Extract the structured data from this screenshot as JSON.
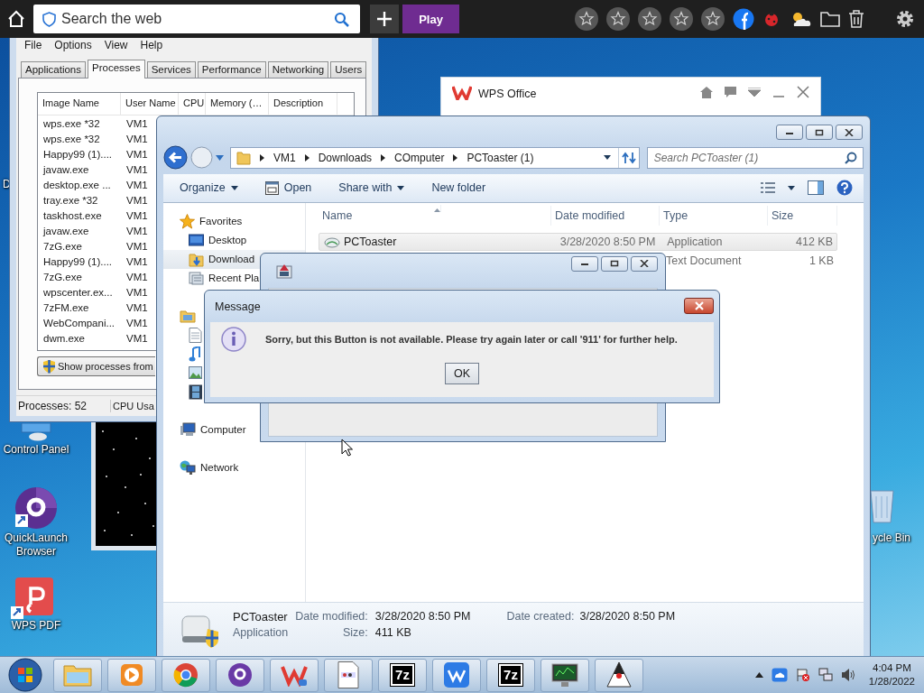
{
  "browser_bar": {
    "search": {
      "placeholder": "Search the web"
    },
    "play_button": "Play"
  },
  "desktop_icons": [
    {
      "label": "D",
      "kind": "none"
    },
    {
      "label": "Control Panel",
      "kind": "control"
    },
    {
      "label": "QuickLaunch Browser",
      "kind": "browser"
    },
    {
      "label": "WPS PDF",
      "kind": "pdf"
    },
    {
      "label": "ycle Bin",
      "kind": "trash"
    }
  ],
  "task_manager": {
    "menu": [
      "File",
      "Options",
      "View",
      "Help"
    ],
    "tabs": [
      {
        "label": "Applications",
        "selected": false
      },
      {
        "label": "Processes",
        "selected": true
      },
      {
        "label": "Services",
        "selected": false
      },
      {
        "label": "Performance",
        "selected": false
      },
      {
        "label": "Networking",
        "selected": false
      },
      {
        "label": "Users",
        "selected": false
      }
    ],
    "columns": [
      "Image Name",
      "User Name",
      "CPU",
      "Memory (…",
      "Description"
    ],
    "rows": [
      {
        "image_name": "wps.exe *32",
        "user_name": "VM1"
      },
      {
        "image_name": "wps.exe *32",
        "user_name": "VM1"
      },
      {
        "image_name": "Happy99 (1)....",
        "user_name": "VM1"
      },
      {
        "image_name": "javaw.exe",
        "user_name": "VM1"
      },
      {
        "image_name": "desktop.exe ...",
        "user_name": "VM1"
      },
      {
        "image_name": "tray.exe *32",
        "user_name": "VM1"
      },
      {
        "image_name": "taskhost.exe",
        "user_name": "VM1"
      },
      {
        "image_name": "javaw.exe",
        "user_name": "VM1"
      },
      {
        "image_name": "7zG.exe",
        "user_name": "VM1"
      },
      {
        "image_name": "Happy99 (1)....",
        "user_name": "VM1"
      },
      {
        "image_name": "7zG.exe",
        "user_name": "VM1"
      },
      {
        "image_name": "wpscenter.ex...",
        "user_name": "VM1"
      },
      {
        "image_name": "7zFM.exe",
        "user_name": "VM1"
      },
      {
        "image_name": "WebCompani...",
        "user_name": "VM1"
      },
      {
        "image_name": "dwm.exe",
        "user_name": "VM1"
      }
    ],
    "button": "Show processes from",
    "status_bar": [
      "Processes: 52",
      "CPU Usa"
    ]
  },
  "wps_window": {
    "title": "WPS Office"
  },
  "explorer": {
    "breadcrumb": [
      "VM1",
      "Downloads",
      "COmputer",
      "PCToaster (1)"
    ],
    "search": {
      "placeholder": "Search PCToaster (1)"
    },
    "toolbar": [
      {
        "label": "Organize",
        "dropdown": true,
        "kind": "text"
      },
      {
        "label": "Open",
        "dropdown": false,
        "kind": "open"
      },
      {
        "label": "Share with",
        "dropdown": true,
        "kind": "text"
      },
      {
        "label": "New folder",
        "dropdown": false,
        "kind": "text"
      }
    ],
    "nav": [
      {
        "label": "Favorites",
        "kind": "favorites",
        "group": true,
        "selected": false
      },
      {
        "label": "Desktop",
        "kind": "desktop",
        "group": false,
        "selected": false
      },
      {
        "label": "Download",
        "kind": "downloads",
        "group": false,
        "selected": true
      },
      {
        "label": "Recent Pla",
        "kind": "recent",
        "group": false,
        "selected": false
      },
      {
        "kind": "libraries",
        "group": true,
        "selected": false
      },
      {
        "kind": "documents",
        "group": false,
        "selected": false
      },
      {
        "kind": "music",
        "group": false,
        "selected": false
      },
      {
        "kind": "pictures",
        "group": false,
        "selected": false
      },
      {
        "kind": "videos",
        "group": false,
        "selected": false
      },
      {
        "label": "Computer",
        "kind": "computer",
        "group": true,
        "selected": false
      },
      {
        "label": "Network",
        "kind": "network",
        "group": true,
        "selected": false
      }
    ],
    "columns": [
      "Name",
      "Date modified",
      "Type",
      "Size"
    ],
    "files": [
      {
        "name": "PCToaster",
        "date_modified": "3/28/2020 8:50 PM",
        "type": "Application",
        "size": "412 KB",
        "selected": true
      },
      {
        "type": "Text Document",
        "size": "1 KB",
        "selected": false
      }
    ],
    "details": {
      "name": "PCToaster",
      "kind": "Application",
      "date_modified_label": "Date modified:",
      "date_modified": "3/28/2020 8:50 PM",
      "size_label": "Size:",
      "size": "411 KB",
      "date_created_label": "Date created:",
      "date_created": "3/28/2020 8:50 PM"
    }
  },
  "message_dialog": {
    "title": "Message",
    "text": "Sorry, but this Button is not available. Please try again later or call '911' for further help.",
    "button": "OK"
  },
  "taskbar": {
    "apps": [
      {
        "kind": "folder"
      },
      {
        "kind": "media"
      },
      {
        "kind": "browser"
      },
      {
        "kind": "quicklaunch"
      },
      {
        "kind": "writer"
      },
      {
        "kind": "document"
      },
      {
        "kind": "archive",
        "label": "7z"
      },
      {
        "kind": "wps"
      },
      {
        "kind": "archive",
        "label": "7z"
      },
      {
        "kind": "monitor"
      },
      {
        "kind": "java"
      }
    ],
    "time": "4:04 PM",
    "date": "1/28/2022"
  }
}
